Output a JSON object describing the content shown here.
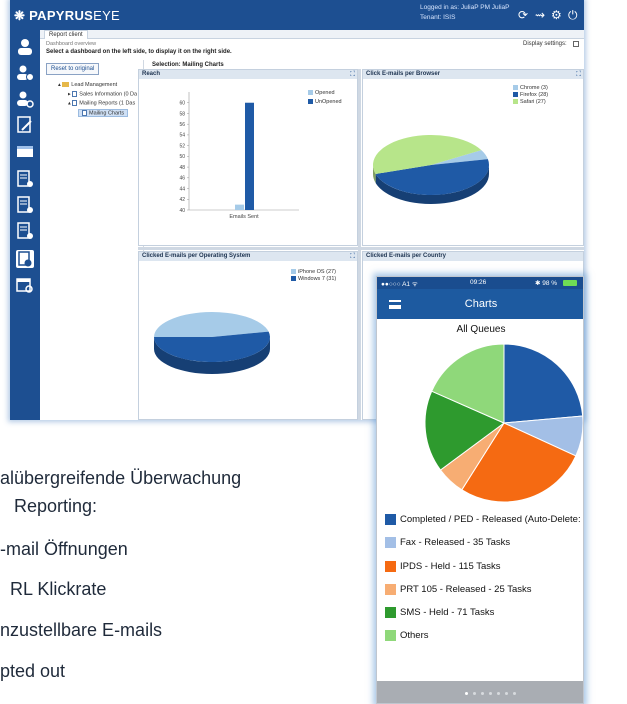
{
  "app": {
    "logo_brand": "PAPYRUS",
    "logo_eye": "EYE",
    "logged_in": "Logged in as:  JuliaP   PM JuliaP",
    "tenant": "Tenant: ISIS"
  },
  "tab": {
    "label": "Report client"
  },
  "breadcrumb": "Dashboard overview",
  "hint": "Select a dashboard on the left side, to display it on the right side.",
  "display_settings": "Display settings:",
  "tree": {
    "reset_label": "Reset to original",
    "items": [
      "Lead Management",
      "Sales Information (0 Da",
      "Mailing Reports (1 Das",
      "Mailing Charts"
    ]
  },
  "selection_title": "Selection: Mailing Charts",
  "panels": {
    "reach": "Reach",
    "browser": "Click E-mails per Browser",
    "os": "Clicked E-mails per Operating System",
    "country": "Clicked E-mails per Country"
  },
  "colors": {
    "nav": "#1d4f91",
    "opened": "#a6cbe8",
    "unopened": "#1f5aa6",
    "green": "#b7e58a"
  },
  "chart_data": [
    {
      "type": "bar",
      "title": "Reach",
      "categories": [
        "Emails Sent"
      ],
      "series": [
        {
          "name": "Opened",
          "values": [
            41
          ]
        },
        {
          "name": "UnOpened",
          "values": [
            60
          ]
        }
      ],
      "ylim": [
        40,
        62
      ],
      "yticks": [
        "60",
        "58",
        "56",
        "54",
        "52",
        "50",
        "48",
        "46",
        "44",
        "42",
        "40"
      ],
      "legend": "top-right"
    },
    {
      "type": "pie",
      "title": "Click E-mails per Browser",
      "labels": [
        "Chrome (3)",
        "Firefox (28)",
        "Safari (27)"
      ],
      "values": [
        3,
        28,
        27
      ],
      "colors": [
        "#a6cbe8",
        "#1f5aa6",
        "#b7e58a"
      ]
    },
    {
      "type": "pie",
      "title": "Clicked E-mails per Operating System",
      "labels": [
        "iPhone OS (27)",
        "Windows 7 (31)"
      ],
      "values": [
        27,
        31
      ],
      "colors": [
        "#a6cbe8",
        "#1f5aa6"
      ]
    },
    {
      "type": "pie",
      "title": "All Queues",
      "labels": [
        "Completed / PED - Released (Auto-Delete: Hou",
        "Fax - Released - 35 Tasks",
        "IPDS - Held - 115 Tasks",
        "PRT 105 - Released - 25 Tasks",
        "SMS - Held - 71 Tasks",
        "Others"
      ],
      "values": [
        100,
        35,
        115,
        25,
        71,
        78
      ],
      "colors": [
        "#1f5aa6",
        "#a3bfe6",
        "#f56a12",
        "#f7ad73",
        "#2e9a2e",
        "#8fd87a"
      ]
    }
  ],
  "phone": {
    "carrier": "●●○○○ A1 ᯤ",
    "time": "09:26",
    "battery": "✱ 98 %",
    "header": "Charts",
    "chart_title": "All Queues"
  },
  "bullets": [
    "alübergreifende Überwachung",
    "Reporting:",
    "-mail Öffnungen",
    "RL Klickrate",
    "nzustellbare E-mails",
    "pted out"
  ]
}
